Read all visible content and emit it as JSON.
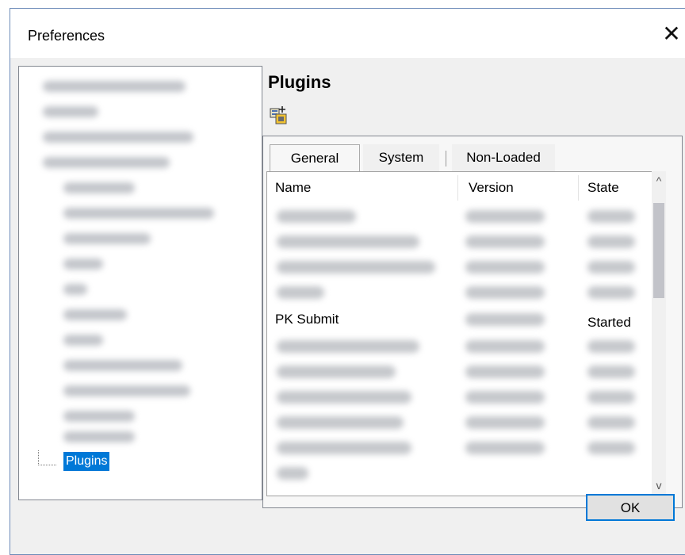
{
  "window": {
    "title": "Preferences",
    "close_glyph": "✕"
  },
  "sidebar": {
    "selected_item": "Plugins"
  },
  "main": {
    "heading": "Plugins",
    "toolbar": {
      "add_plugin_icon": "add-plugin-icon"
    },
    "tabs": [
      {
        "label": "General"
      },
      {
        "label": "System"
      },
      {
        "label": "Non-Loaded"
      }
    ],
    "table": {
      "columns": [
        "Name",
        "Version",
        "State"
      ],
      "visible_row": {
        "name": "PK Submit",
        "state": "Started"
      }
    },
    "scroll": {
      "up": "^",
      "down": "v"
    }
  },
  "footer": {
    "ok_label": "OK"
  },
  "colors": {
    "selection": "#0078d7",
    "border": "#828790",
    "dialog_bg": "#f0f0f0"
  }
}
